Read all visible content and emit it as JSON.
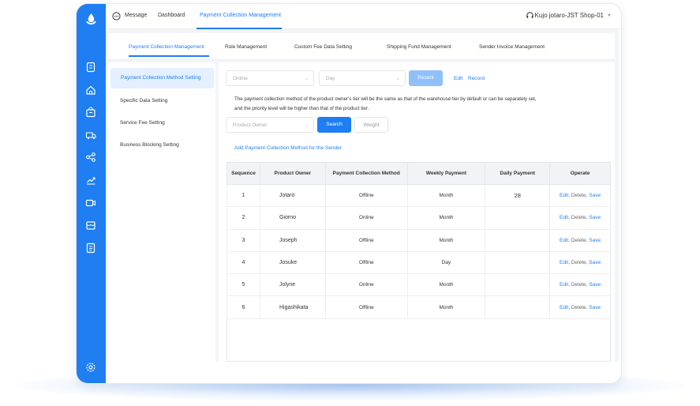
{
  "topbar": {
    "message": "Message",
    "dashboard": "Dashboard",
    "active": "Payment Collection Management",
    "user": "Kujo jotaro-JST Shop-01"
  },
  "tabs": [
    {
      "label": "Payment Collection Management"
    },
    {
      "label": "Rule Management"
    },
    {
      "label": "Custom Fee Data Setting"
    },
    {
      "label": "Shipping Fund Management"
    },
    {
      "label": "Sender Invoice Management"
    }
  ],
  "leftnav": [
    {
      "label": "Payment Collection Method Setting"
    },
    {
      "label": "Specific Data Setting"
    },
    {
      "label": "Service Fee Setting"
    },
    {
      "label": "Business Blocking Setting"
    }
  ],
  "filters": {
    "method": "Online",
    "period": "Day",
    "recent_button": "Recent",
    "edit_link": "Edit",
    "record_link": "Record",
    "product_owner_placeholder": "Product Owner",
    "search_button": "Search",
    "weight_button": "Weight"
  },
  "description": {
    "line1": "The payment collection method of the product owner's tier will be the same as that of the warehouse tier by default or can be separately set,",
    "line2": "and the priority level will be higher than that of the product tier."
  },
  "add_link": "Add Payment Collection Method for the Sender",
  "table": {
    "headers": [
      "Sequence",
      "Product Owner",
      "Payment Collection Method",
      "Weekly Payment",
      "Daily Payment",
      "Operate"
    ],
    "rows": [
      {
        "seq": "1",
        "owner": "Jotaro",
        "method": "Offline",
        "weekly": "Month",
        "daily": "28",
        "ops": [
          "Edit",
          "Delete",
          "Save"
        ]
      },
      {
        "seq": "2",
        "owner": "Giorno",
        "method": "Online",
        "weekly": "Month",
        "daily": "",
        "ops": [
          "Edit",
          "Delete",
          "Save"
        ]
      },
      {
        "seq": "3",
        "owner": "Joseph",
        "method": "Offline",
        "weekly": "Month",
        "daily": "",
        "ops": [
          "Edit",
          "Delete",
          "Save"
        ]
      },
      {
        "seq": "4",
        "owner": "Josuke",
        "method": "Offline",
        "weekly": "Day",
        "daily": "",
        "ops": [
          "Edit",
          "Delete",
          "Save"
        ]
      },
      {
        "seq": "5",
        "owner": "Jolyne",
        "method": "Online",
        "weekly": "Month",
        "daily": "",
        "ops": [
          "Edit",
          "Delete",
          "Save"
        ]
      },
      {
        "seq": "6",
        "owner": "Higashikata",
        "method": "Offline",
        "weekly": "Month",
        "daily": "",
        "ops": [
          "Edit",
          "Delete",
          "Save"
        ]
      }
    ]
  },
  "sidebar_icons": [
    "document-icon",
    "home-icon",
    "bag-icon",
    "truck-icon",
    "share-icon",
    "trend-icon",
    "video-icon",
    "store-icon",
    "list-icon",
    "settings-icon"
  ],
  "colors": {
    "primary": "#1e7ef2",
    "primary_light": "#8fc0fa",
    "active_bg": "#e4efff"
  }
}
